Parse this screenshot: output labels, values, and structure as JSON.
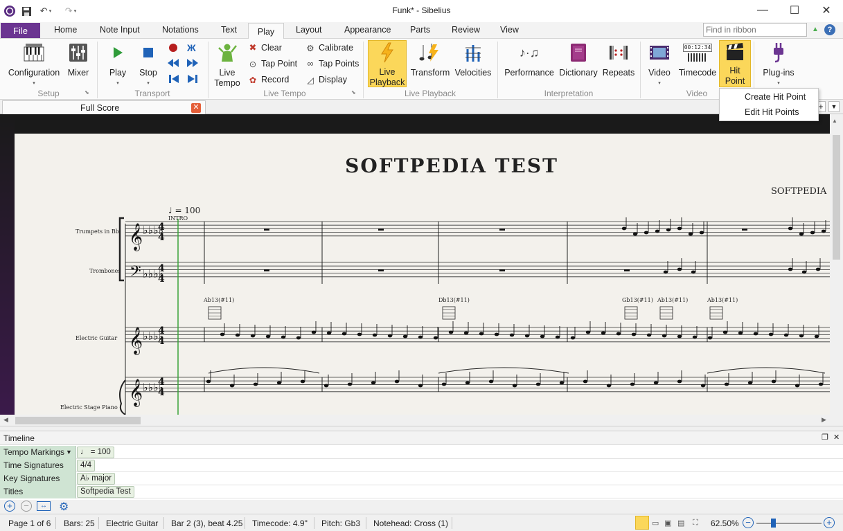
{
  "window": {
    "title": "Funk* - Sibelius"
  },
  "tabs": {
    "file": "File",
    "items": [
      "Home",
      "Note Input",
      "Notations",
      "Text",
      "Play",
      "Layout",
      "Appearance",
      "Parts",
      "Review",
      "View"
    ],
    "active": "Play"
  },
  "find": {
    "placeholder": "Find in ribbon"
  },
  "ribbon": {
    "setup": {
      "label": "Setup",
      "configuration": "Configuration",
      "mixer": "Mixer"
    },
    "transport": {
      "label": "Transport",
      "play": "Play",
      "stop": "Stop"
    },
    "live_tempo": {
      "label": "Live Tempo",
      "live_tempo_line1": "Live",
      "live_tempo_line2": "Tempo",
      "clear": "Clear",
      "tap_point": "Tap Point",
      "record": "Record",
      "calibrate": "Calibrate",
      "tap_points": "Tap Points",
      "display": "Display"
    },
    "live_playback": {
      "label": "Live Playback",
      "live_playback_line1": "Live",
      "live_playback_line2": "Playback",
      "transform": "Transform",
      "velocities": "Velocities"
    },
    "interpretation": {
      "label": "Interpretation",
      "performance": "Performance",
      "dictionary": "Dictionary",
      "repeats": "Repeats"
    },
    "video": {
      "label": "Video",
      "video": "Video",
      "timecode": "Timecode",
      "timecode_readout": "00:12:34",
      "hit_point_line1": "Hit",
      "hit_point_line2": "Point",
      "plugins": "Plug-ins"
    }
  },
  "hit_point_menu": {
    "create": "Create Hit Point",
    "edit": "Edit Hit Points"
  },
  "document": {
    "tab": "Full Score"
  },
  "score": {
    "title": "SOFTPEDIA TEST",
    "composer": "SOFTPEDIA EDI",
    "tempo": "= 100",
    "section": "INTRO",
    "instruments": [
      "Trumpets in Bb",
      "Trombones",
      "Electric Guitar",
      "Electric Stage Piano"
    ],
    "time_signature": "4/4",
    "chords": [
      "Ab13(#11)",
      "Db13(#11)",
      "Gb13(#11)",
      "Ab13(#11)",
      "Ab13(#11)"
    ]
  },
  "timeline": {
    "title": "Timeline",
    "rows": [
      {
        "label": "Tempo Markings",
        "value": "♩ = 100"
      },
      {
        "label": "Time Signatures",
        "value": "4/4"
      },
      {
        "label": "Key Signatures",
        "value": "A♭ major"
      },
      {
        "label": "Titles",
        "value": "Softpedia Test"
      }
    ]
  },
  "status": {
    "page": "Page 1 of 6",
    "bars": "Bars: 25",
    "instrument": "Electric Guitar",
    "position": "Bar 2 (3), beat 4.25",
    "timecode": "Timecode: 4.9\"",
    "pitch": "Pitch: Gb3",
    "notehead": "Notehead: Cross (1)",
    "zoom": "62.50%"
  },
  "colors": {
    "accent": "#6b3591",
    "highlight": "#fbd75a",
    "timeline_label": "#cfe4d3"
  }
}
